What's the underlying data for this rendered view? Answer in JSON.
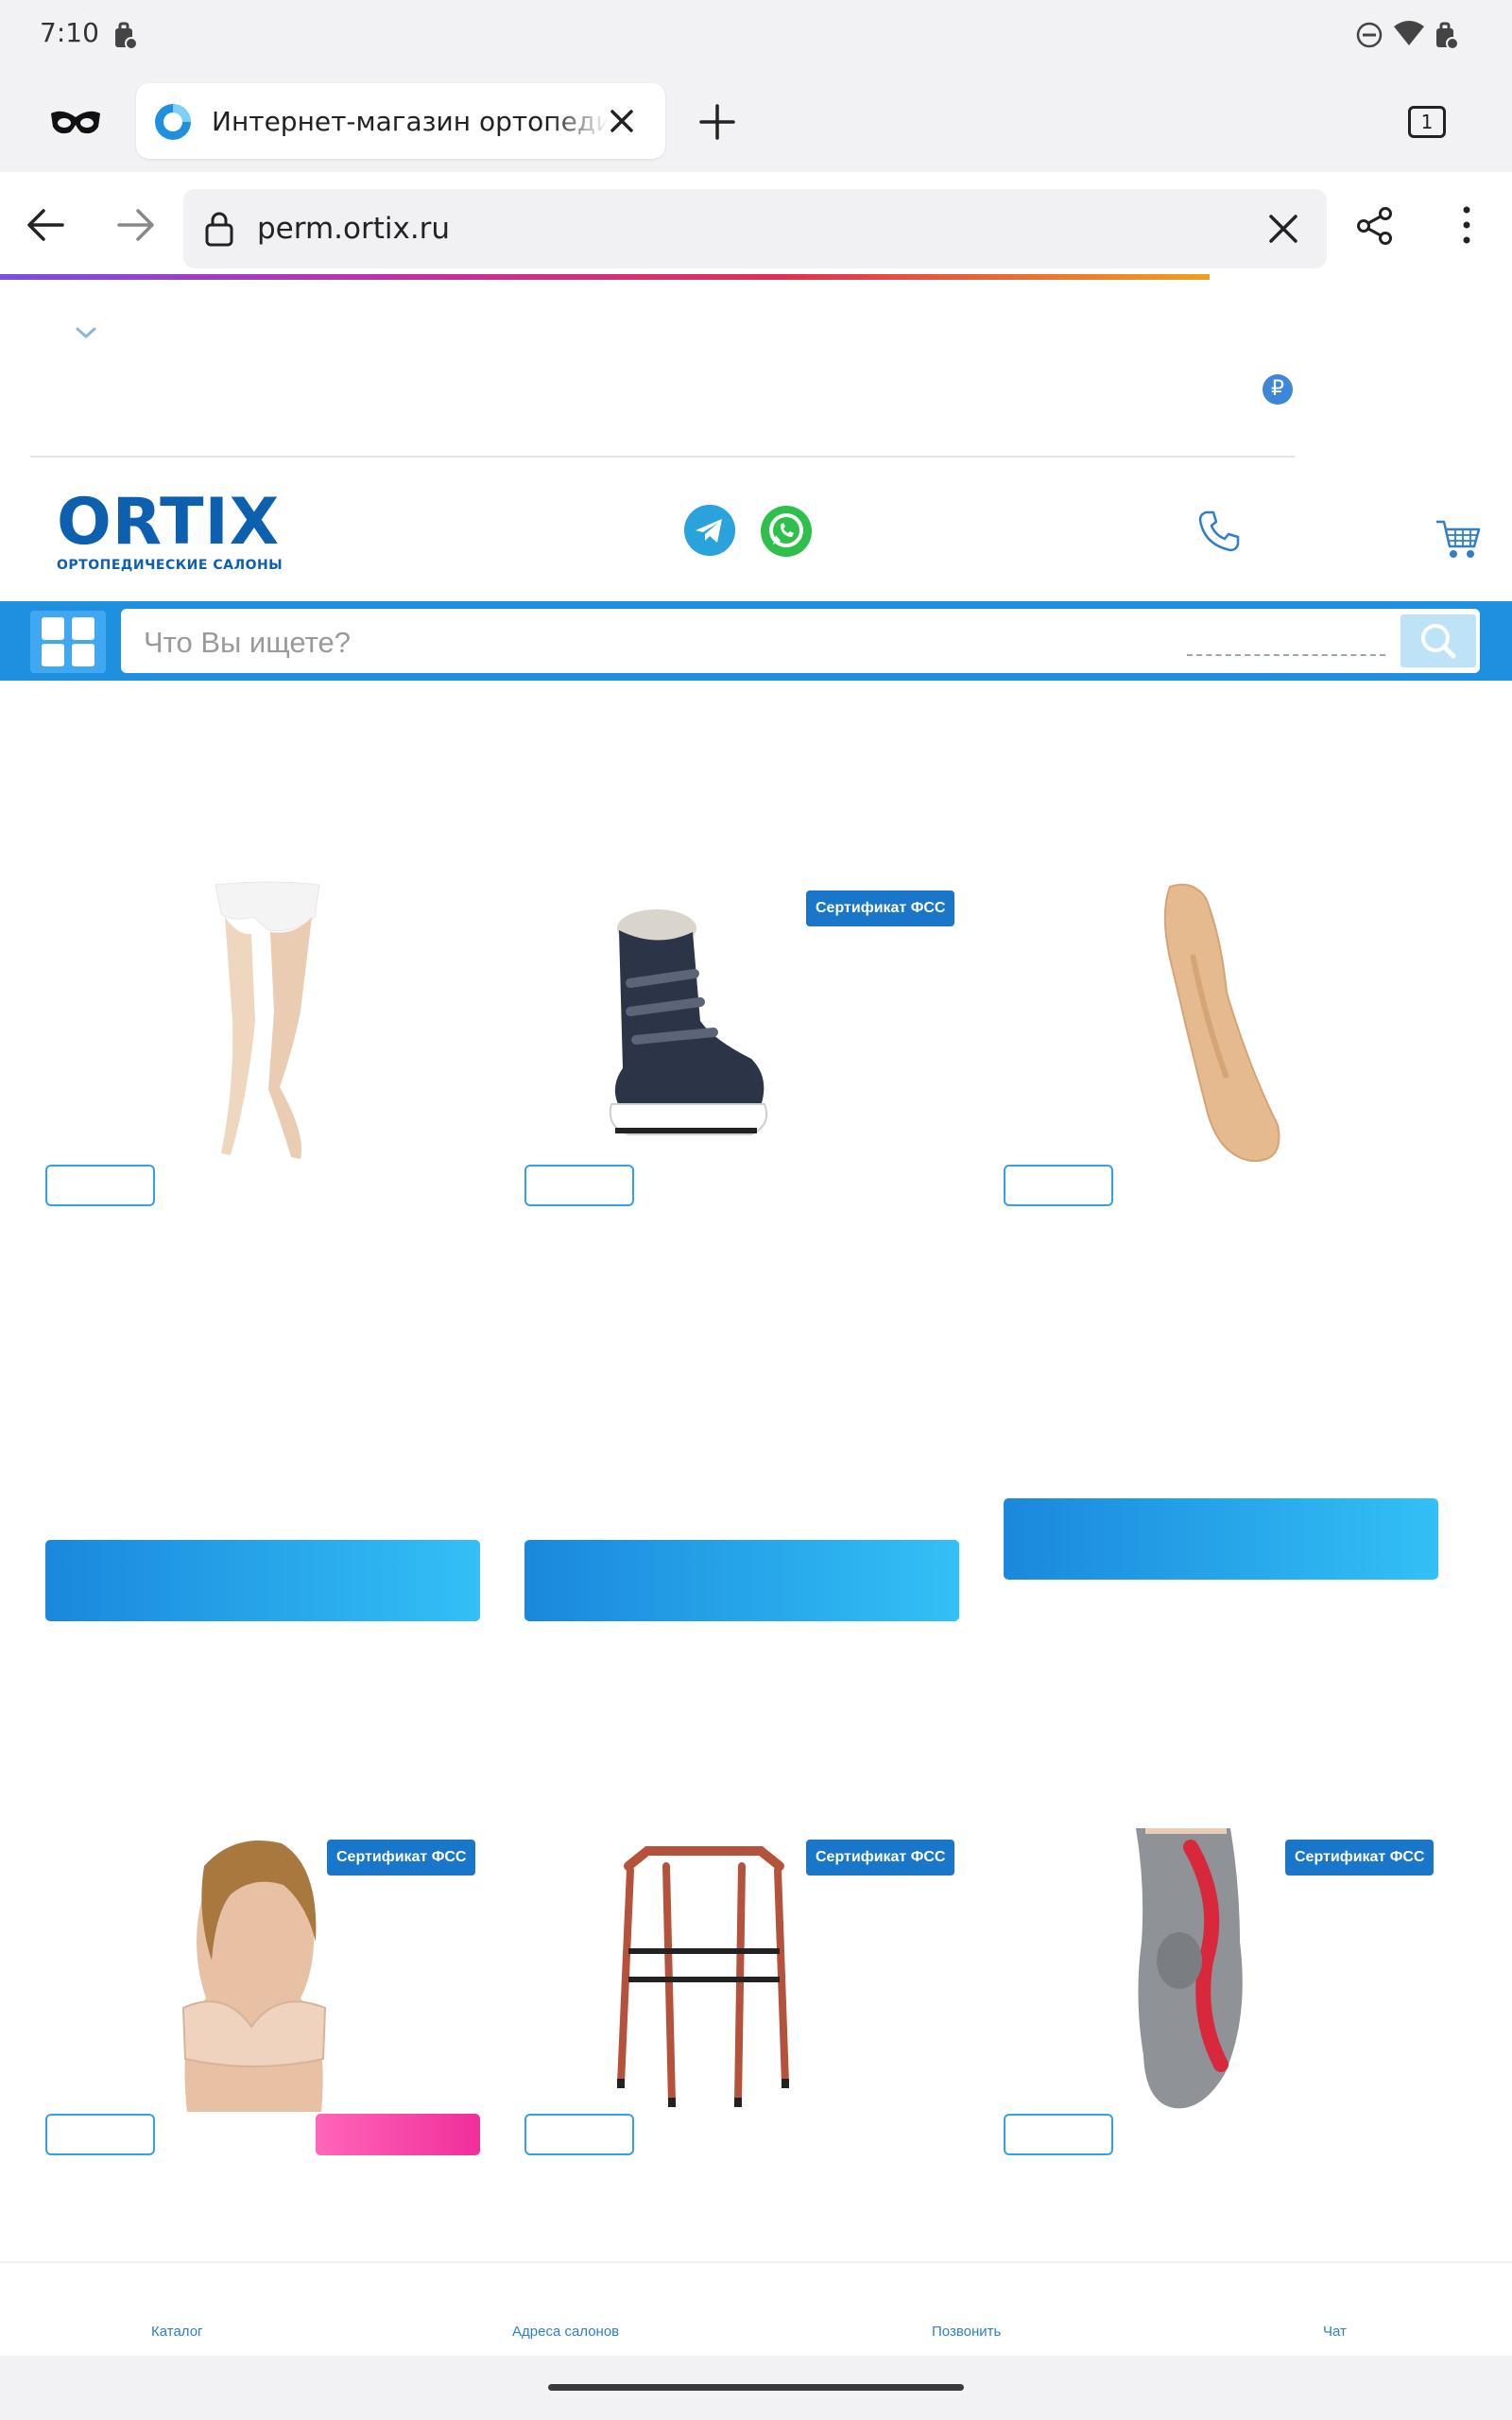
{
  "status_bar": {
    "time": "7:10"
  },
  "browser": {
    "tab_title": "Интернет-магазин ортопедии",
    "tab_count": "1",
    "url": "perm.ortix.ru"
  },
  "site": {
    "currency_symbol": "₽",
    "logo": {
      "main": "ORTIX",
      "sub": "ОРТОПЕДИЧЕСКИЕ САЛОНЫ"
    },
    "search": {
      "placeholder": "Что Вы ищете?"
    }
  },
  "products": [
    {
      "badge": ""
    },
    {
      "badge": "Сертификат ФСС"
    },
    {
      "badge": ""
    },
    {
      "badge": "Сертификат ФСС"
    },
    {
      "badge": "Сертификат ФСС"
    },
    {
      "badge": "Сертификат ФСС"
    }
  ],
  "bottom_nav": {
    "items": [
      "Каталог",
      "Адреса салонов",
      "Позвонить",
      "Чат"
    ]
  },
  "colors": {
    "brand_blue": "#0d5fb0",
    "accent_blue": "#1f8fe0",
    "badge_blue": "#1a76c8",
    "pink": "#f02e9c"
  }
}
